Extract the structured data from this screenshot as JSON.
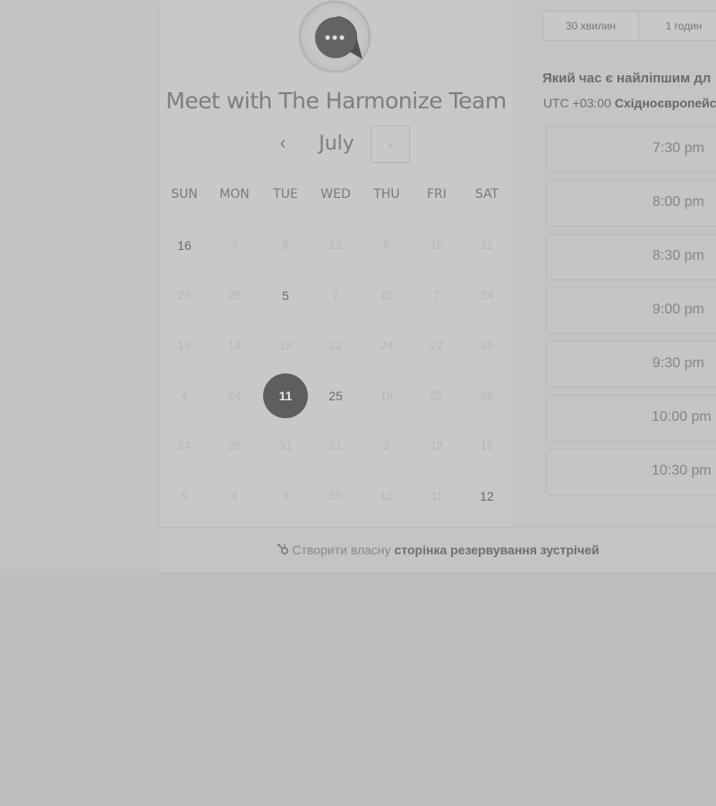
{
  "header": {
    "title": "Meet with The Harmonize Team"
  },
  "calendar": {
    "month": "July",
    "prev_label": "‹",
    "next_label": "›",
    "weekdays": [
      "SUN",
      "MON",
      "TUE",
      "WED",
      "THU",
      "FRI",
      "SAT"
    ],
    "rows": [
      [
        {
          "d": "16",
          "s": "avail"
        },
        {
          "d": "7",
          "s": "disabled"
        },
        {
          "d": "8",
          "s": "disabled"
        },
        {
          "d": "12",
          "s": "disabled"
        },
        {
          "d": "6",
          "s": "disabled"
        },
        {
          "d": "16",
          "s": "disabled"
        },
        {
          "d": "11",
          "s": "disabled"
        }
      ],
      [
        {
          "d": "25",
          "s": "disabled"
        },
        {
          "d": "28",
          "s": "disabled"
        },
        {
          "d": "5",
          "s": "avail"
        },
        {
          "d": "7",
          "s": "disabled"
        },
        {
          "d": "10",
          "s": "disabled"
        },
        {
          "d": "7",
          "s": "disabled"
        },
        {
          "d": "24",
          "s": "disabled"
        }
      ],
      [
        {
          "d": "15",
          "s": "disabled"
        },
        {
          "d": "19",
          "s": "disabled"
        },
        {
          "d": "19",
          "s": "disabled"
        },
        {
          "d": "22",
          "s": "disabled"
        },
        {
          "d": "24",
          "s": "disabled"
        },
        {
          "d": "22",
          "s": "disabled"
        },
        {
          "d": "20",
          "s": "disabled"
        }
      ],
      [
        {
          "d": "4",
          "s": "disabled"
        },
        {
          "d": "24",
          "s": "disabled"
        },
        {
          "d": "11",
          "s": "selected"
        },
        {
          "d": "25",
          "s": "avail"
        },
        {
          "d": "19",
          "s": "disabled"
        },
        {
          "d": "25",
          "s": "disabled"
        },
        {
          "d": "26",
          "s": "disabled"
        }
      ],
      [
        {
          "d": "24",
          "s": "disabled"
        },
        {
          "d": "25",
          "s": "disabled"
        },
        {
          "d": "31",
          "s": "disabled"
        },
        {
          "d": "21",
          "s": "disabled"
        },
        {
          "d": "3",
          "s": "disabled"
        },
        {
          "d": "13",
          "s": "disabled"
        },
        {
          "d": "16",
          "s": "disabled"
        }
      ],
      [
        {
          "d": "5",
          "s": "disabled"
        },
        {
          "d": "4",
          "s": "disabled"
        },
        {
          "d": "9",
          "s": "disabled"
        },
        {
          "d": "30",
          "s": "disabled"
        },
        {
          "d": "12",
          "s": "disabled"
        },
        {
          "d": "11",
          "s": "disabled"
        },
        {
          "d": "12",
          "s": "avail"
        }
      ]
    ]
  },
  "scheduler": {
    "durations": [
      "30 хвилин",
      "1 годин"
    ],
    "question": "Який час є найліпшим дл",
    "tz_prefix": "UTC +03:00 ",
    "tz_name": "Східноєвропейс",
    "slots": [
      "7:30 pm",
      "8:00 pm",
      "8:30 pm",
      "9:00 pm",
      "9:30 pm",
      "10:00 pm",
      "10:30 pm"
    ]
  },
  "footer": {
    "prefix": "Створити власну ",
    "link": "сторінка резервування зустрічей"
  },
  "colors": {
    "overlay_bg": "#bebebe",
    "selected_day": "#5e5e5e",
    "logo_ring": "#b4b4b4",
    "logo_bubble": "#5c5c5c"
  },
  "icons": {
    "logo": "chat-bubble-logo",
    "footer": "sprocket-icon",
    "prev": "chevron-left-icon",
    "next": "chevron-right-icon"
  }
}
